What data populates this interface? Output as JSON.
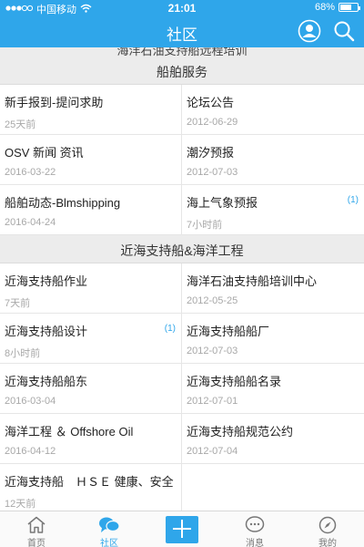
{
  "status_bar": {
    "carrier": "中国移动",
    "time": "21:01",
    "battery": "68%",
    "battery_level": 0.68,
    "signal_icon": "signal-dots-icon",
    "wifi_icon": "wifi-icon"
  },
  "header": {
    "title": "社区",
    "user_icon": "user-icon",
    "search_icon": "search-icon"
  },
  "partial_section_title": "海洋石油支持船远程培训",
  "sections": [
    {
      "title": "船舶服务",
      "items": [
        {
          "name": "新手报到-提问求助",
          "sub": "25天前",
          "badge": ""
        },
        {
          "name": "论坛公告",
          "sub": "2012-06-29",
          "badge": ""
        },
        {
          "name": "OSV 新闻 资讯",
          "sub": "2016-03-22",
          "badge": ""
        },
        {
          "name": "潮汐预报",
          "sub": "2012-07-03",
          "badge": ""
        },
        {
          "name": "船舶动态-Blmshipping",
          "sub": "2016-04-24",
          "badge": ""
        },
        {
          "name": "海上气象预报",
          "sub": "7小时前",
          "badge": "(1)"
        }
      ]
    },
    {
      "title": "近海支持船&海洋工程",
      "items": [
        {
          "name": "近海支持船作业",
          "sub": "7天前",
          "badge": ""
        },
        {
          "name": "海洋石油支持船培训中心",
          "sub": "2012-05-25",
          "badge": ""
        },
        {
          "name": "近海支持船设计",
          "sub": "8小时前",
          "badge": "(1)"
        },
        {
          "name": "近海支持船船厂",
          "sub": "2012-07-03",
          "badge": ""
        },
        {
          "name": "近海支持船船东",
          "sub": "2016-03-04",
          "badge": ""
        },
        {
          "name": "近海支持船船名录",
          "sub": "2012-07-01",
          "badge": ""
        },
        {
          "name": "海洋工程 ＆ Offshore Oil",
          "sub": "2016-04-12",
          "badge": ""
        },
        {
          "name": "近海支持船规范公约",
          "sub": "2012-07-04",
          "badge": ""
        },
        {
          "name": "近海支持船　ＨＳＥ 健康、安全",
          "sub": "12天前",
          "badge": ""
        },
        {
          "name": "",
          "sub": "",
          "badge": ""
        }
      ]
    }
  ],
  "tabbar": {
    "tabs": [
      {
        "label": "首页",
        "icon": "home-icon",
        "active": false
      },
      {
        "label": "社区",
        "icon": "chat-bubble-icon",
        "active": true
      },
      {
        "label": "",
        "icon": "plus-icon",
        "active": false
      },
      {
        "label": "消息",
        "icon": "message-icon",
        "active": false
      },
      {
        "label": "我的",
        "icon": "compass-icon",
        "active": false
      }
    ]
  },
  "colors": {
    "accent": "#2fa6ea",
    "section_bg": "#ececec",
    "muted_text": "#a8a8a8"
  }
}
